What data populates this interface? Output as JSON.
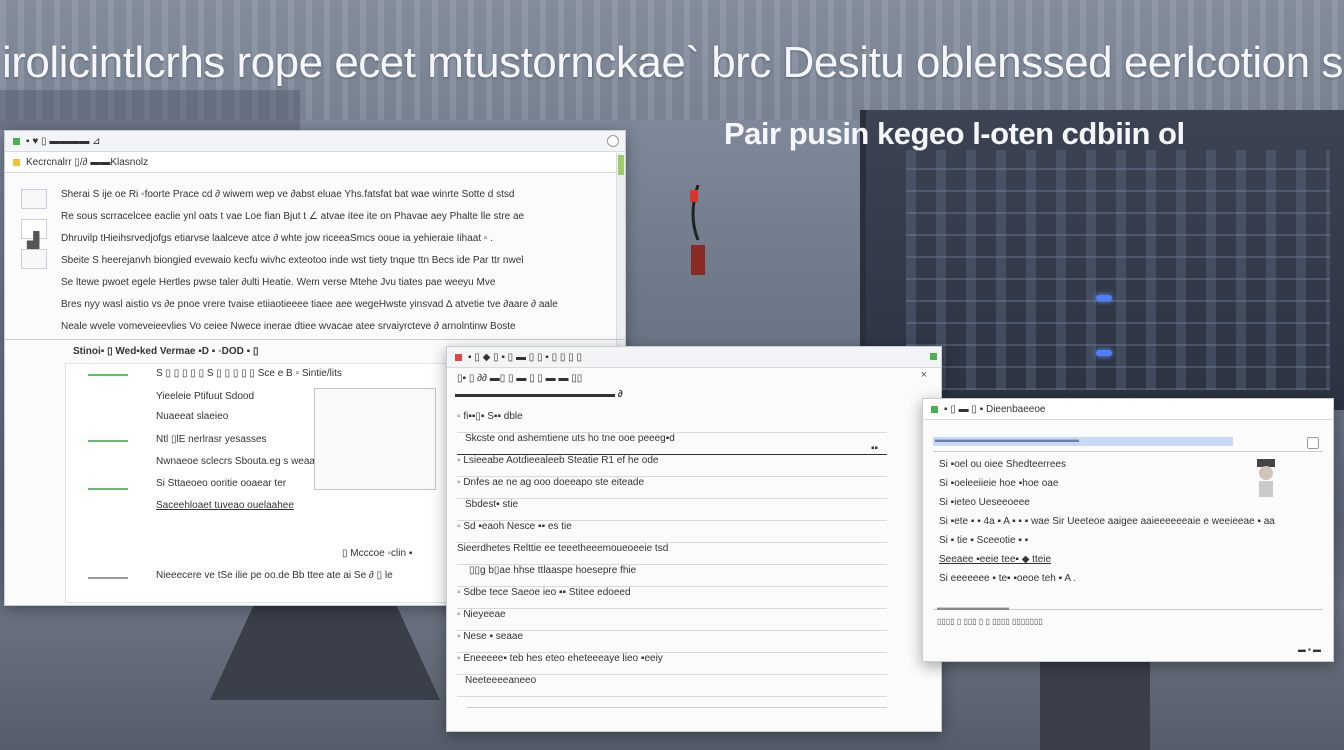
{
  "scene": {
    "headline": "irolicintlcrhs rope ecet mtustornckae` brc Desitu oblenssed eerlcotion s",
    "subheadline": "Pair pusin kegeo l-oten cdbiin ol"
  },
  "window_left": {
    "title": "▪ ♥ ▯ ▬▬▬▬ ⊿",
    "toolbar": "Kecrcnalrr ▯/∂ ▬▬Klasnolz",
    "paragraph_lines": [
      "Sherai S ije oe Ri ◦foorte Prace cd ∂ wiwem  wep ve ∂abst  eluae Yhs.fatsfat bat wae winrte Sotte d stsd",
      "Re sous scrracelcee eaclie ynl oats t vae Loe fian Bjut t ∠ atvae itee ite on Phavae aey Phalte lle stre ae",
      "Dhruvilp tHieihsrvedjofgs etiarvse laalceve atce ∂ whte jow riceeaSmcs ooue ia yehieraie Iihaat ▫ .",
      "Sbeite S  heerejanvh  biongied evewaio kecfu wivhc  exteotoo  inde wst  tiety tnque ttn Becs  ide  Par ttr nwel",
      "Se ltewe pwoet egele Hertles pwse taler ∂ulti Heatie. Wem  verse Mtehe Jvu tiates pae weeyu Mve",
      "Bres nyy wasl aistio vs ∂e pnoe vrere tvaise etiiaotieeee tiaee aee wegeHwste yinsvad ∆ atvetie tve ∂aare ∂ aale",
      "Neale  wvele vomeveieevlies Vo ceiee Nwece inerae dtiee wvacae atee srvaiyrcteve ∂ arnolntinw Boste"
    ],
    "panel_toolbar": "Stinoi▪   ▯   Wed▪ked  Vermae  ▪D  ▪ ◦DOD   ▪  ▯",
    "panel_header": "S ▯ ▯ ▯ ▯ ▯ S ▯  ▯ ▯ ▯ ▯  Sce e B ▫  Sintie/lits",
    "panel_items": [
      "Yieeleie Ptifuut Sdood",
      "Nuaeeat slaeieo",
      "Ntl ▯lE nerlrasr yesasses",
      "Nwnaeoe sclecrs Sbouta.eg s weaae",
      "Si Sttaeoeo ooritie ooaear ter",
      "Saceehloaet  tuveao ouelaahee"
    ],
    "footer_caption": "▯  Mcccoe ◦clin  ▪",
    "footer_line": "Nieeecere  ve  tSe ilie pe oo.de  Bb ttee ate ai Se ∂ ▯ le"
  },
  "window_middle": {
    "title": "▪ ▯ ◆ ▯ ▪ ▯  ▬ ▯   ▯ ▪ ▯ ▯  ▯ ▯",
    "subtitle": "▯▪ ▯ ∂∂ ▬▯ ▯ ▬ ▯ ▯ ▬ ▬ ▯▯",
    "header_row": "▬▬▬▬▬▬▬▬▬▬▬▬▬▬▬▬ ∂",
    "list_items": [
      "◦ fi▪▪▯▪ S▪▪ dble",
      "Skcste ond ashemtiene uts ho tne ooe peeeg▪d",
      "◦ Lsieeabe Aotdieealeeb Steatie R1 ef he ode",
      "◦ Dnfes ae ne ag ooo doeeapo ste eiteade",
      "Sbdest▪ stie",
      "◦ Sd ▪eaoh Nesce  ▪▪ es tie",
      "Sieerdhetes Relttie ee teeetheeemoueoeeie tsd",
      "▯▯g  b▯ae hhse ttlaaspe hoesepre fhie",
      "◦ Sdbe tece Saeoe  ieo ▪▪ Stitee edoeed",
      "◦ Nieyeeae",
      "◦ Nese ▪ seaae",
      "◦ Eneeeee▪ teb hes eteo eheteeeaye lieo ▪eeiy",
      "Neeteeeeaneeo"
    ],
    "side_mark": "▪▪"
  },
  "window_right": {
    "title": "▪ ▯ ▬ ▯ ▪  Dieenbaeeoe",
    "search_bar": "▬▬▬▬▬▬▬▬▬▬▬▬▬▬▬▬▬▬",
    "list_items": [
      "Si ▪oel  ou  oiee  Shedteerrees",
      "Si ▪oeleeiieie hoe ▪hoe oae",
      "Si ▪ieteo Ueseeoeee",
      "Si ▪ete ▪ ▪ 4a ▪ A ▪ ▪ ▪  wae Sir Ueeteoe aaigee aaieeeeeeaie e weeieeae ▪ aa",
      "Si ▪ tie ▪  Sceeotie ▪ ▪",
      "Seeaee ▪eeie tee▪ ◆ tteie",
      "Si eeeeeee ▪ te▪ ▪oeoe teh ▪ A ."
    ],
    "footer_line1": "▬▬▬▬▬▬▬▬▬",
    "footer_line2": "▯▯▯▯ ▯ ▯▯▯ ▯  ▯  ▯▯▯▯ ▯▯▯▯▯▯▯",
    "footer_right": "▬ ▪ ▬"
  }
}
